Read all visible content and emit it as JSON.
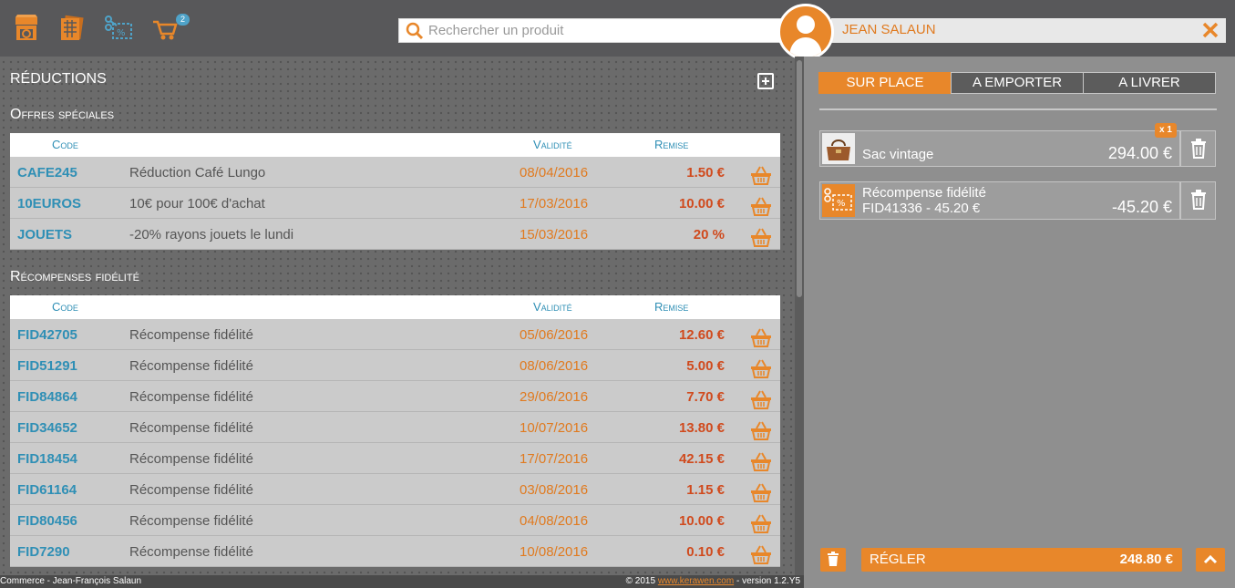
{
  "header": {
    "nav_icons": [
      "shop-icon",
      "catalog-icon",
      "discount-icon",
      "cart-icon"
    ],
    "cart_badge": "2",
    "search_placeholder": "Rechercher un produit",
    "customer_name": "JEAN SALAUN"
  },
  "reductions": {
    "title": "RÉDUCTIONS",
    "special_offers": {
      "title": "Offres spéciales",
      "headers": {
        "code": "Code",
        "validity": "Validité",
        "discount": "Remise"
      },
      "rows": [
        {
          "code": "CAFE245",
          "desc": "Réduction Café Lungo",
          "date": "08/04/2016",
          "amount": "1.50 €"
        },
        {
          "code": "10EUROS",
          "desc": "10€ pour 100€ d'achat",
          "date": "17/03/2016",
          "amount": "10.00 €"
        },
        {
          "code": "JOUETS",
          "desc": "-20% rayons jouets le lundi",
          "date": "15/03/2016",
          "amount": "20 %"
        }
      ]
    },
    "loyalty": {
      "title": "Récompenses fidélité",
      "headers": {
        "code": "Code",
        "validity": "Validité",
        "discount": "Remise"
      },
      "rows": [
        {
          "code": "FID42705",
          "desc": "Récompense fidélité",
          "date": "05/06/2016",
          "amount": "12.60 €"
        },
        {
          "code": "FID51291",
          "desc": "Récompense fidélité",
          "date": "08/06/2016",
          "amount": "5.00 €"
        },
        {
          "code": "FID84864",
          "desc": "Récompense fidélité",
          "date": "29/06/2016",
          "amount": "7.70 €"
        },
        {
          "code": "FID34652",
          "desc": "Récompense fidélité",
          "date": "10/07/2016",
          "amount": "13.80 €"
        },
        {
          "code": "FID18454",
          "desc": "Récompense fidélité",
          "date": "17/07/2016",
          "amount": "42.15 €"
        },
        {
          "code": "FID61164",
          "desc": "Récompense fidélité",
          "date": "03/08/2016",
          "amount": "1.15 €"
        },
        {
          "code": "FID80456",
          "desc": "Récompense fidélité",
          "date": "04/08/2016",
          "amount": "10.00 €"
        },
        {
          "code": "FID7290",
          "desc": "Récompense fidélité",
          "date": "10/08/2016",
          "amount": "0.10 €"
        }
      ]
    }
  },
  "footer": {
    "left": "Commerce - Jean-François Salaun",
    "right_prefix": "© 2015 ",
    "right_link": "www.kerawen.com",
    "right_suffix": " - version 1.2.Y5"
  },
  "order": {
    "modes": [
      "SUR PLACE",
      "A EMPORTER",
      "A LIVRER"
    ],
    "active_mode": 0,
    "items": [
      {
        "name": "Sac vintage",
        "qty": "x 1",
        "price": "294.00 €"
      },
      {
        "name": "Récompense fidélité",
        "sub": "FID41336 - 45.20 €",
        "price": "-45.20 €"
      }
    ],
    "pay_label": "RÉGLER",
    "total": "248.80 €"
  },
  "colors": {
    "accent": "#e8872a",
    "code_blue": "#2f8fb5",
    "amount_red": "#d04a1d"
  }
}
